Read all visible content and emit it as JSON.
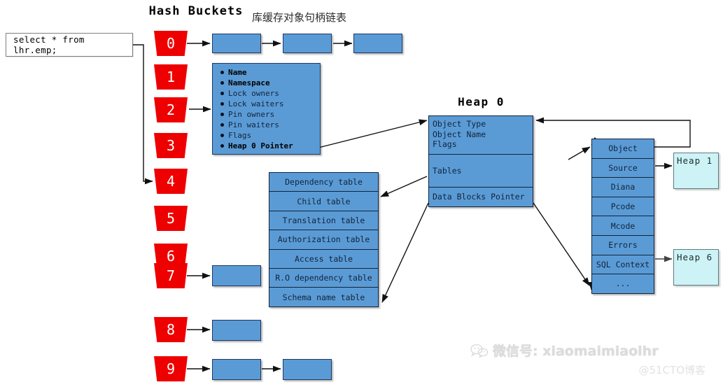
{
  "titles": {
    "hash_buckets": "Hash Buckets",
    "chinese_caption": "库缓存对象句柄链表",
    "heap0": "Heap 0"
  },
  "sql": {
    "text": "select * from lhr.emp;"
  },
  "buckets": [
    {
      "label": "0"
    },
    {
      "label": "1"
    },
    {
      "label": "2"
    },
    {
      "label": "3"
    },
    {
      "label": "4"
    },
    {
      "label": "5"
    },
    {
      "label": "6"
    },
    {
      "label": "7"
    },
    {
      "label": "8"
    },
    {
      "label": "9"
    }
  ],
  "handle": {
    "items": [
      {
        "label": "Name",
        "bold": true
      },
      {
        "label": "Namespace",
        "bold": true
      },
      {
        "label": "Lock owners",
        "bold": false
      },
      {
        "label": "Lock waiters",
        "bold": false
      },
      {
        "label": "Pin owners",
        "bold": false
      },
      {
        "label": "Pin waiters",
        "bold": false
      },
      {
        "label": "Flags",
        "bold": false
      },
      {
        "label": "Heap 0 Pointer",
        "bold": true
      }
    ]
  },
  "heap0": {
    "line1": "Object Type",
    "line2": "Object Name",
    "line3": "Flags",
    "tables": "Tables",
    "data_blocks": "Data Blocks Pointer"
  },
  "tables_stack": [
    "Dependency table",
    "Child table",
    "Translation table",
    "Authorization table",
    "Access table",
    "R.O dependency table",
    "Schema name table"
  ],
  "object_stack": [
    "Object",
    "Source",
    "Diana",
    "Pcode",
    "Mcode",
    "Errors",
    "SQL Context",
    "..."
  ],
  "heaps": [
    {
      "label": "Heap 1"
    },
    {
      "label": "Heap 6"
    }
  ],
  "watermark": {
    "main": "微信号: xiaomaimiaolhr",
    "sub": "@51CTO博客"
  },
  "colors": {
    "bucket_red": "#ee0000",
    "box_blue": "#5b9bd5",
    "heap_cyan": "#cdf3f6",
    "border_dark": "#10243d"
  }
}
